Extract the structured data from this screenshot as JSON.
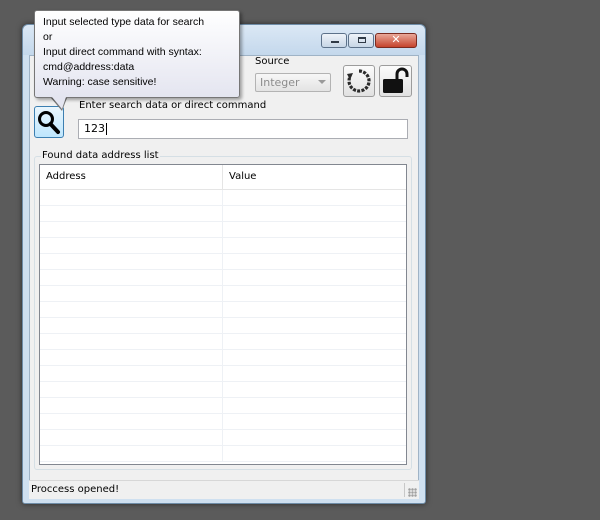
{
  "source": {
    "label": "Source",
    "selected": "Integer"
  },
  "search": {
    "label": "Enter search data or direct command",
    "value": "123"
  },
  "results": {
    "group_label": "Found data address list",
    "columns": [
      "Address",
      "Value"
    ],
    "rows": []
  },
  "status": {
    "text": "Proccess opened!"
  },
  "tooltip": {
    "lines": [
      "Input selected type data for search",
      "or",
      "Input direct command with syntax:",
      "cmd@address:data",
      "Warning: case sensitive!"
    ]
  },
  "icons": {
    "search": "magnifier-icon",
    "refresh": "refresh-icon",
    "lock": "unlock-icon",
    "minimize": "minimize-icon",
    "maximize": "maximize-icon",
    "close": "close-icon"
  },
  "colors": {
    "desktop": "#5b5b5b",
    "window_frame": "#cfe0f0",
    "close_button": "#c5432c"
  }
}
